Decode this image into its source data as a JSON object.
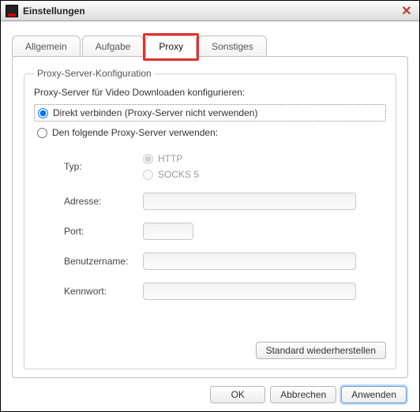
{
  "window": {
    "title": "Einstellungen"
  },
  "tabs": [
    {
      "label": "Allgemein"
    },
    {
      "label": "Aufgabe"
    },
    {
      "label": "Proxy",
      "active": true
    },
    {
      "label": "Sonstiges"
    }
  ],
  "proxy": {
    "group_title": "Proxy-Server-Konfiguration",
    "group_label": "Proxy-Server für Video Downloaden konfigurieren:",
    "option_direct": "Direkt verbinden (Proxy-Server nicht verwenden)",
    "option_use_proxy": "Den folgende Proxy-Server verwenden:",
    "selected_option": "direct",
    "type_label": "Typ:",
    "type_options": {
      "http": "HTTP",
      "socks5": "SOCKS 5"
    },
    "type_selected": "http",
    "address_label": "Adresse:",
    "address_value": "",
    "port_label": "Port:",
    "port_value": "",
    "username_label": "Benutzername:",
    "username_value": "",
    "password_label": "Kennwort:",
    "password_value": "",
    "restore_button": "Standard wiederherstellen"
  },
  "footer": {
    "ok": "OK",
    "cancel": "Abbrechen",
    "apply": "Anwenden"
  }
}
